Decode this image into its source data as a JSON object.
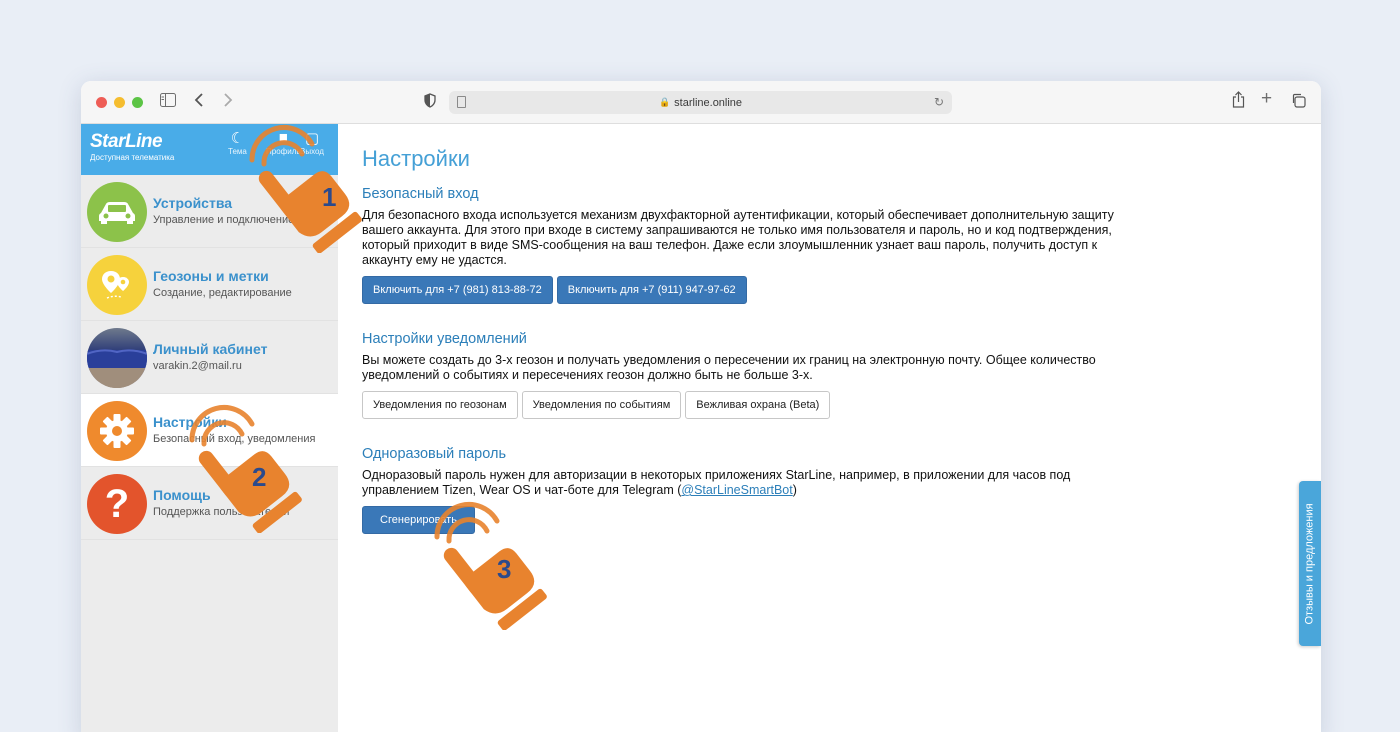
{
  "browser": {
    "url": "starline.online"
  },
  "brand": {
    "name": "StarLine",
    "tagline": "Доступная телематика",
    "actions": [
      {
        "label": "Тема",
        "icon": "moon-icon"
      },
      {
        "label": "Профиль",
        "icon": "profile-icon"
      },
      {
        "label": "Выход",
        "icon": "exit-icon"
      }
    ]
  },
  "sidebar": {
    "items": [
      {
        "title": "Устройства",
        "subtitle": "Управление и подключение",
        "icon": "car-icon",
        "color": "#8cc24a"
      },
      {
        "title": "Геозоны и метки",
        "subtitle": "Создание, редактирование",
        "icon": "map-pin-icon",
        "color": "#f6d23c"
      },
      {
        "title": "Личный кабинет",
        "subtitle": "varakin.2@mail.ru",
        "icon": "avatar",
        "color": "#3a4c7a"
      },
      {
        "title": "Настройки",
        "subtitle": "Безопасный вход, уведомления",
        "icon": "gear-icon",
        "color": "#ef8a2d"
      },
      {
        "title": "Помощь",
        "subtitle": "Поддержка пользователей",
        "icon": "question-icon",
        "color": "#e3542c"
      }
    ]
  },
  "main": {
    "title": "Настройки",
    "secure_login": {
      "heading": "Безопасный вход",
      "text": "Для безопасного входа используется механизм двухфакторной аутентификации, который обеспечивает дополнительную защиту вашего аккаунта. Для этого при входе в систему запрашиваются не только имя пользователя и пароль, но и код подтверждения, который приходит в виде SMS-сообщения на ваш телефон. Даже если злоумышленник узнает ваш пароль, получить доступ к аккаунту ему не удастся.",
      "buttons": [
        "Включить для +7 (981) 813-88-72",
        "Включить для +7 (911) 947-97-62"
      ]
    },
    "notifications": {
      "heading": "Настройки уведомлений",
      "text": "Вы можете создать до 3-х геозон и получать уведомления о пересечении их границ на электронную почту. Общее количество уведомлений о событиях и пересечениях геозон должно быть не больше 3-х.",
      "buttons": [
        "Уведомления по геозонам",
        "Уведомления по событиям",
        "Вежливая охрана (Beta)"
      ]
    },
    "otp": {
      "heading": "Одноразовый пароль",
      "text_before": "Одноразовый пароль нужен для авторизации в некоторых приложениях StarLine, например, в приложении для часов под управлением Tizen, Wear OS и чат-боте для Telegram (",
      "link": "@StarLineSmartBot",
      "text_after": ")",
      "button": "Сгенерировать"
    }
  },
  "feedback_tab": "Отзывы и предложения",
  "callouts": [
    "1",
    "2",
    "3"
  ],
  "colors": {
    "accent": "#45a0d6",
    "primary_button": "#3a78b8",
    "callout": "#e8832e",
    "callout_number": "#2b4a8c"
  }
}
